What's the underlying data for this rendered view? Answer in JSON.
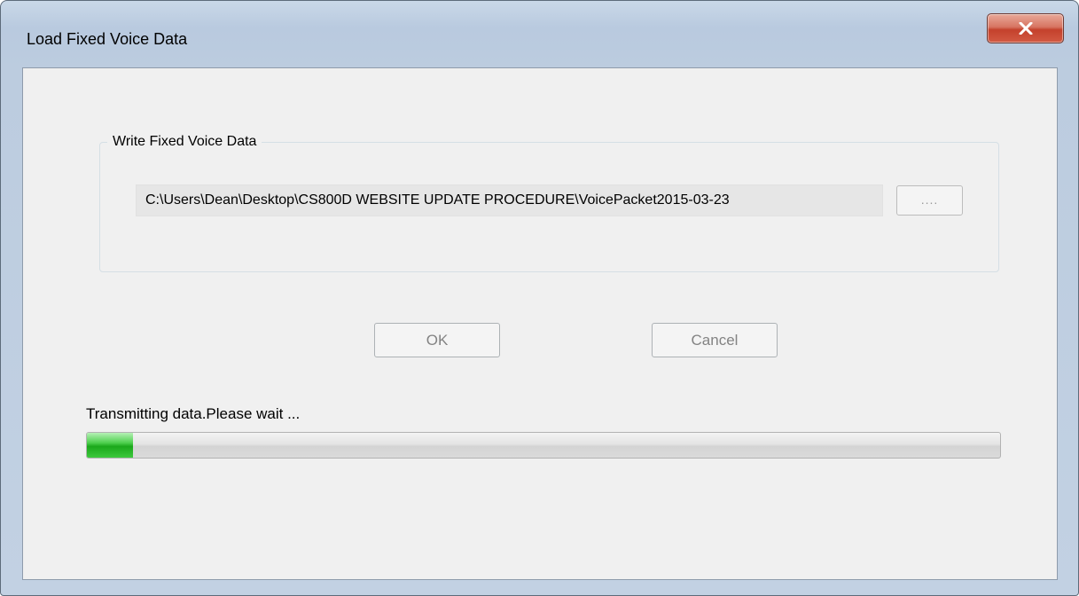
{
  "window": {
    "title": "Load Fixed Voice Data",
    "close_icon": "close-icon"
  },
  "group": {
    "legend": "Write Fixed Voice Data",
    "path_value": "C:\\Users\\Dean\\Desktop\\CS800D WEBSITE UPDATE PROCEDURE\\VoicePacket2015-03-23",
    "browse_label": "...."
  },
  "buttons": {
    "ok_label": "OK",
    "cancel_label": "Cancel"
  },
  "status": {
    "text": "Transmitting data.Please wait ...",
    "progress_percent": 5
  },
  "colors": {
    "close_button": "#c4412c",
    "progress_fill": "#1ba81b"
  }
}
